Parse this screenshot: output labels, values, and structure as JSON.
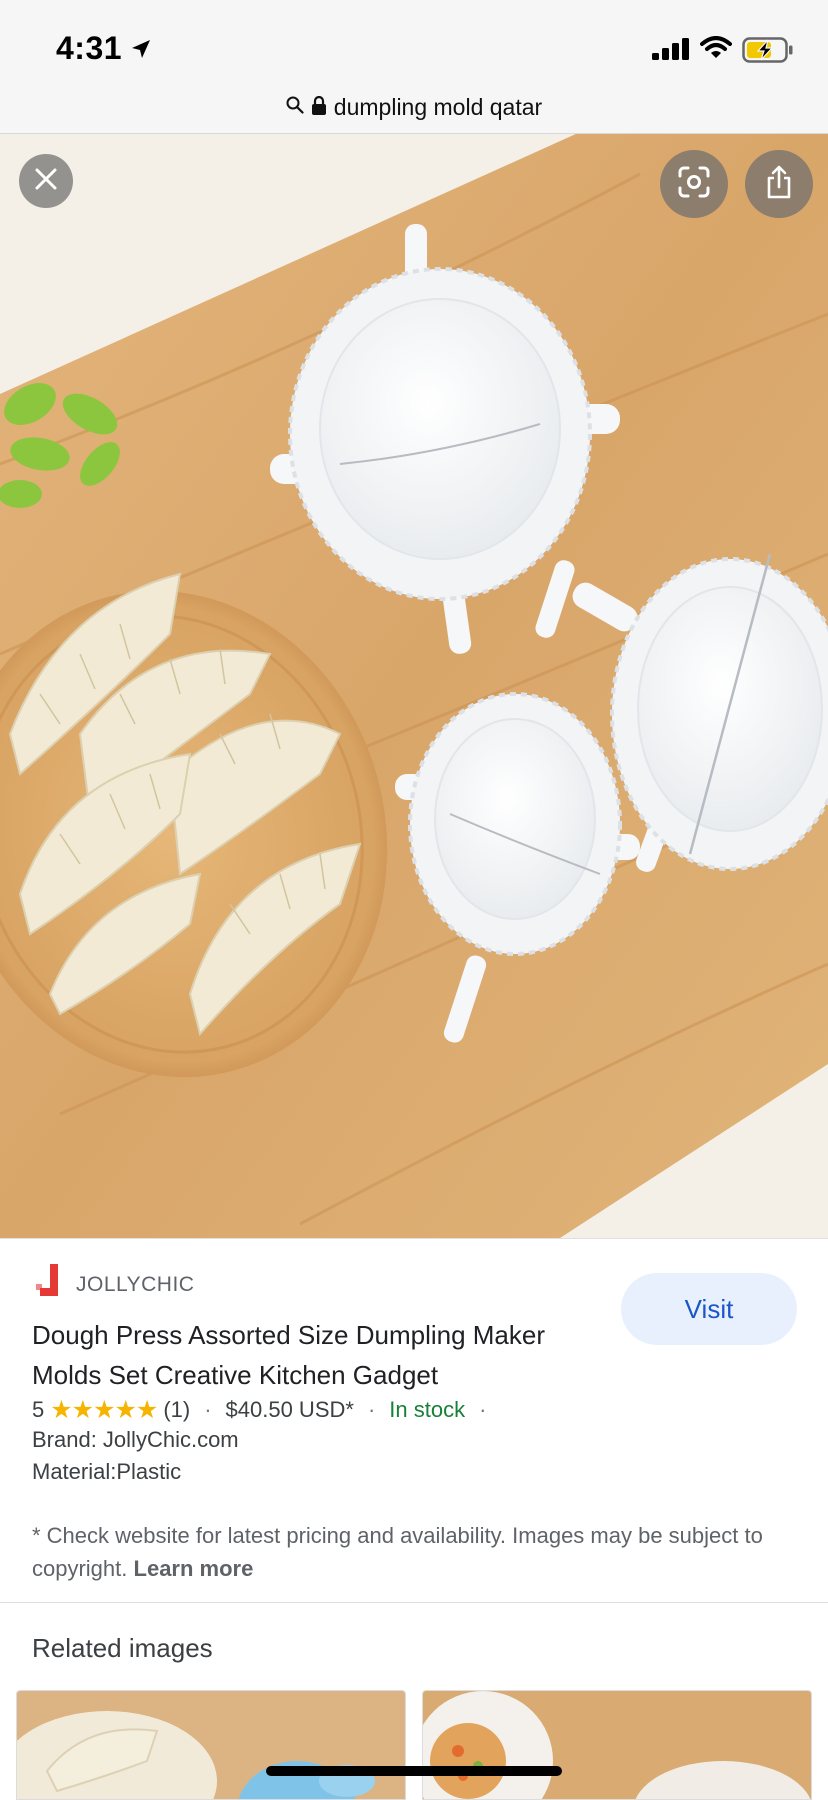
{
  "status_bar": {
    "time": "4:31",
    "icons": [
      "location-arrow-icon",
      "signal-icon",
      "wifi-icon",
      "battery-charging-icon"
    ]
  },
  "url_bar": {
    "icons": [
      "search-icon",
      "lock-icon"
    ],
    "text": "dumpling mold qatar"
  },
  "viewer": {
    "buttons": [
      "close-icon",
      "lens-icon",
      "share-icon"
    ]
  },
  "product": {
    "brand": "JOLLYCHIC",
    "brand_color": "#e53935",
    "title": "Dough Press Assorted Size Dumpling Maker Molds Set Creative Kitchen Gadget",
    "rating": "5",
    "stars_count": 5,
    "review_count": "(1)",
    "price": "$40.50 USD*",
    "availability": "In stock",
    "brand_line": "Brand: JollyChic.com",
    "material_line": "Material:Plastic",
    "visit_label": "Visit",
    "disclaimer": "* Check website for latest pricing and availability. Images may be subject to copyright.",
    "learn_more": "Learn more"
  },
  "related": {
    "heading": "Related images"
  },
  "colors": {
    "accent": "#1a56c8",
    "stock": "#188038",
    "star": "#f6b400"
  }
}
